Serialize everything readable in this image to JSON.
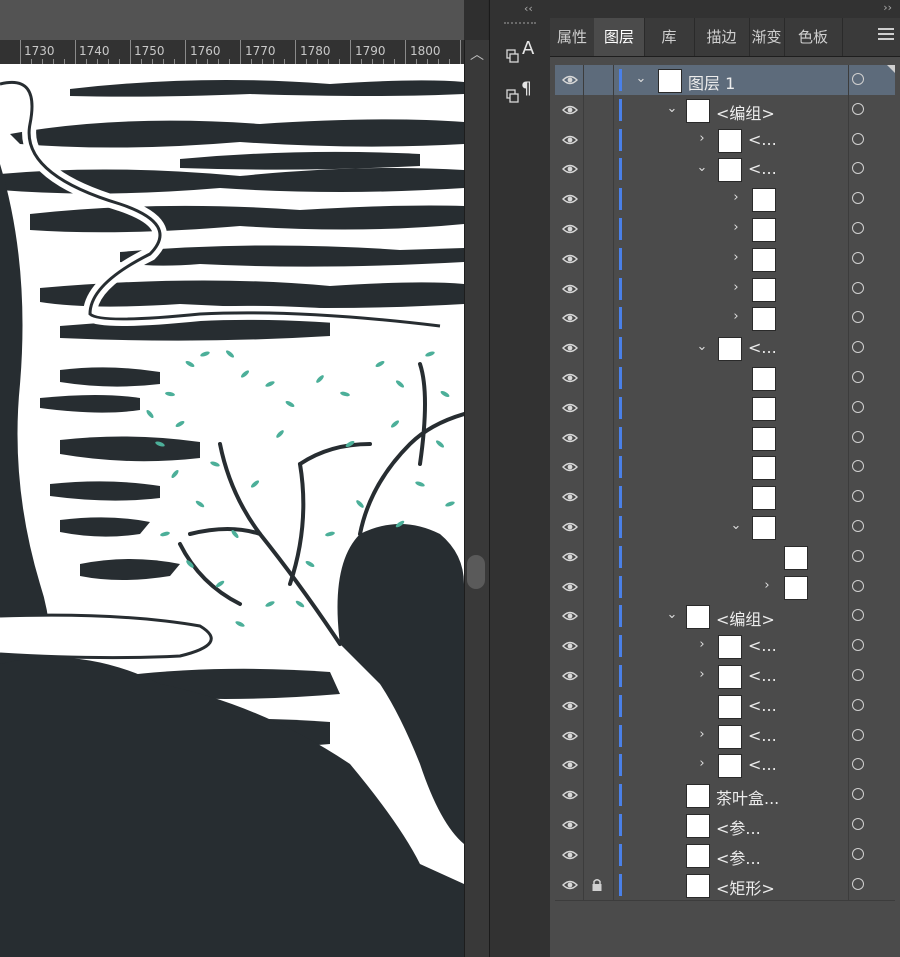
{
  "ruler": {
    "labels": [
      "1730",
      "1740",
      "1750",
      "1760",
      "1770",
      "1780",
      "1790",
      "1800"
    ]
  },
  "panel": {
    "tabs": [
      "属性",
      "图层",
      "库",
      "描边",
      "渐变",
      "色板"
    ],
    "active_tab": "图层"
  },
  "colors": {
    "accent_bar": "#4a80e8",
    "ink": "#272d31",
    "leaf": "#4caf99",
    "selected_row": "#5d6b7b"
  },
  "layers": [
    {
      "label": "图层 1",
      "indent": 0,
      "chevron": "down",
      "selected": true
    },
    {
      "label": "<编组>",
      "indent": 1,
      "chevron": "down"
    },
    {
      "label": "<...",
      "indent": 2,
      "chevron": "right"
    },
    {
      "label": "<...",
      "indent": 2,
      "chevron": "down"
    },
    {
      "label": "",
      "indent": 3,
      "chevron": "right"
    },
    {
      "label": "",
      "indent": 3,
      "chevron": "right"
    },
    {
      "label": "",
      "indent": 3,
      "chevron": "right"
    },
    {
      "label": "",
      "indent": 3,
      "chevron": "right"
    },
    {
      "label": "",
      "indent": 3,
      "chevron": "right"
    },
    {
      "label": "<...",
      "indent": 2,
      "chevron": "down"
    },
    {
      "label": "",
      "indent": 3,
      "chevron": ""
    },
    {
      "label": "",
      "indent": 3,
      "chevron": ""
    },
    {
      "label": "",
      "indent": 3,
      "chevron": ""
    },
    {
      "label": "",
      "indent": 3,
      "chevron": ""
    },
    {
      "label": "",
      "indent": 3,
      "chevron": ""
    },
    {
      "label": "",
      "indent": 3,
      "chevron": "down"
    },
    {
      "label": "",
      "indent": 4,
      "chevron": ""
    },
    {
      "label": "",
      "indent": 4,
      "chevron": "right"
    },
    {
      "label": "<编组>",
      "indent": 1,
      "chevron": "down"
    },
    {
      "label": "<...",
      "indent": 2,
      "chevron": "right"
    },
    {
      "label": "<...",
      "indent": 2,
      "chevron": "right"
    },
    {
      "label": "<...",
      "indent": 2,
      "chevron": ""
    },
    {
      "label": "<...",
      "indent": 2,
      "chevron": "right"
    },
    {
      "label": "<...",
      "indent": 2,
      "chevron": "right"
    },
    {
      "label": "茶叶盒...",
      "indent": 1,
      "chevron": ""
    },
    {
      "label": "<参...",
      "indent": 1,
      "chevron": ""
    },
    {
      "label": "<参...",
      "indent": 1,
      "chevron": ""
    },
    {
      "label": "<矩形>",
      "indent": 1,
      "chevron": "",
      "locked": true
    }
  ]
}
